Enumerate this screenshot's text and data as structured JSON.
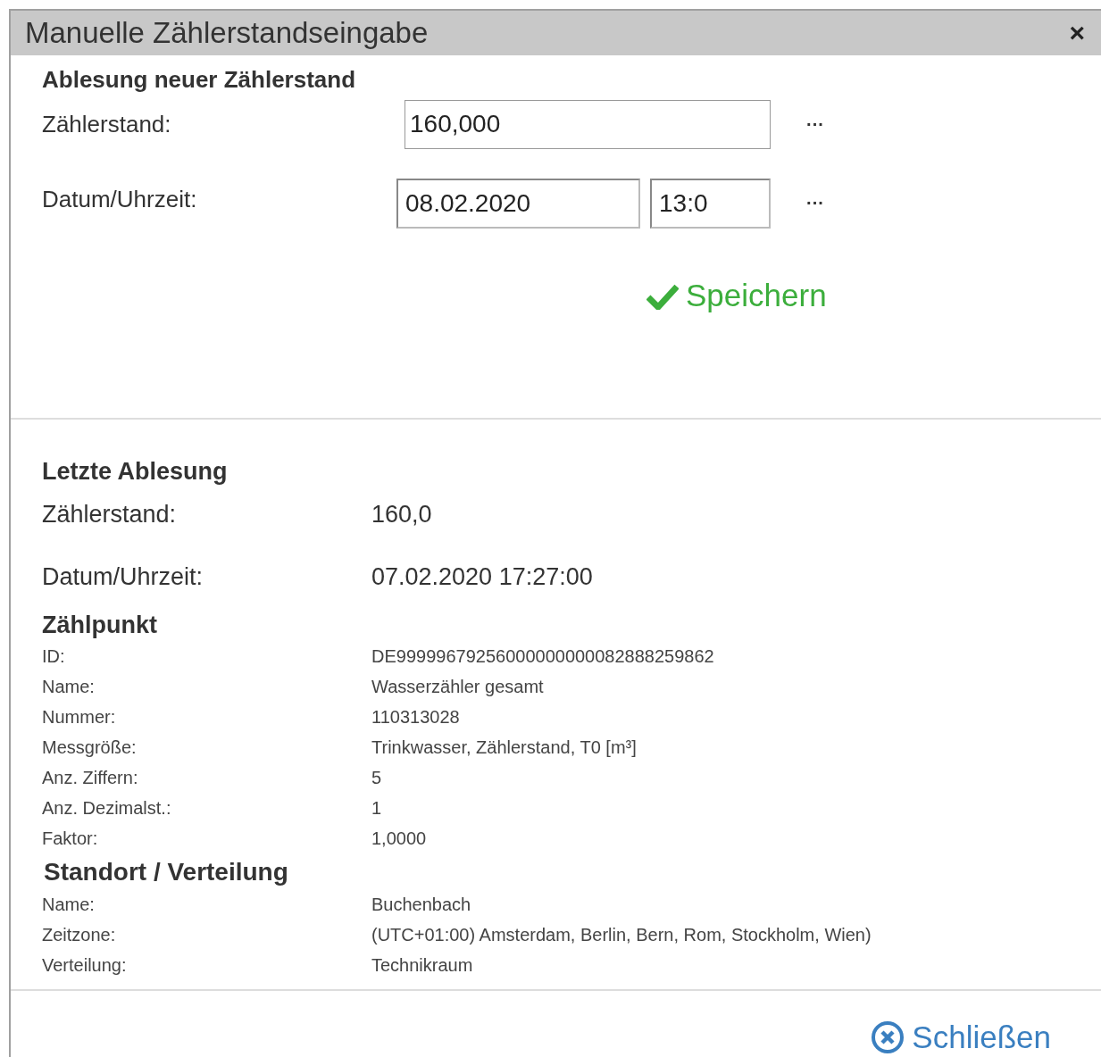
{
  "window": {
    "title": "Manuelle Zählerstandseingabe",
    "close": "×"
  },
  "new_reading": {
    "heading": "Ablesung neuer Zählerstand",
    "meter_label": "Zählerstand:",
    "meter_value": "160,000",
    "meter_more": "···",
    "datetime_label": "Datum/Uhrzeit:",
    "date_value": "08.02.2020",
    "time_value": "13:0",
    "datetime_more": "···",
    "save": "Speichern"
  },
  "last_reading": {
    "heading": "Letzte Ablesung",
    "rows": [
      {
        "label": "Zählerstand:",
        "value": "160,0"
      },
      {
        "label": "Datum/Uhrzeit:",
        "value": "07.02.2020 17:27:00"
      }
    ]
  },
  "sections": [
    {
      "heading": "Zählpunkt",
      "rows": [
        {
          "label": "ID:",
          "value": "DE99999679256000000000082888259862"
        },
        {
          "label": "Name:",
          "value": "Wasserzähler gesamt"
        },
        {
          "label": "Nummer:",
          "value": "110313028"
        },
        {
          "label": "Messgröße:",
          "value": "Trinkwasser, Zählerstand, T0 [m³]"
        },
        {
          "label": "Anz. Ziffern:",
          "value": "5"
        },
        {
          "label": "Anz. Dezimalst.:",
          "value": "1"
        },
        {
          "label": "Faktor:",
          "value": "1,0000"
        }
      ]
    },
    {
      "heading": "Standort / Verteilung",
      "rows": [
        {
          "label": "Name:",
          "value": "Buchenbach"
        },
        {
          "label": "Zeitzone:",
          "value": "(UTC+01:00) Amsterdam, Berlin, Bern, Rom, Stockholm, Wien)"
        },
        {
          "label": "Verteilung:",
          "value": "Technikraum"
        }
      ]
    }
  ],
  "footer": {
    "close": "Schließen"
  }
}
